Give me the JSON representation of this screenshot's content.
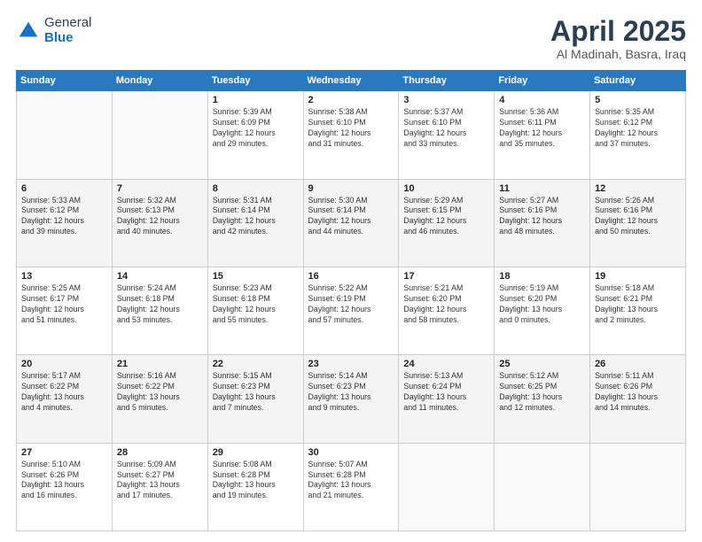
{
  "header": {
    "logo_general": "General",
    "logo_blue": "Blue",
    "title": "April 2025",
    "subtitle": "Al Madinah, Basra, Iraq"
  },
  "days_of_week": [
    "Sunday",
    "Monday",
    "Tuesday",
    "Wednesday",
    "Thursday",
    "Friday",
    "Saturday"
  ],
  "weeks": [
    [
      {
        "day": "",
        "detail": ""
      },
      {
        "day": "",
        "detail": ""
      },
      {
        "day": "1",
        "detail": "Sunrise: 5:39 AM\nSunset: 6:09 PM\nDaylight: 12 hours\nand 29 minutes."
      },
      {
        "day": "2",
        "detail": "Sunrise: 5:38 AM\nSunset: 6:10 PM\nDaylight: 12 hours\nand 31 minutes."
      },
      {
        "day": "3",
        "detail": "Sunrise: 5:37 AM\nSunset: 6:10 PM\nDaylight: 12 hours\nand 33 minutes."
      },
      {
        "day": "4",
        "detail": "Sunrise: 5:36 AM\nSunset: 6:11 PM\nDaylight: 12 hours\nand 35 minutes."
      },
      {
        "day": "5",
        "detail": "Sunrise: 5:35 AM\nSunset: 6:12 PM\nDaylight: 12 hours\nand 37 minutes."
      }
    ],
    [
      {
        "day": "6",
        "detail": "Sunrise: 5:33 AM\nSunset: 6:12 PM\nDaylight: 12 hours\nand 39 minutes."
      },
      {
        "day": "7",
        "detail": "Sunrise: 5:32 AM\nSunset: 6:13 PM\nDaylight: 12 hours\nand 40 minutes."
      },
      {
        "day": "8",
        "detail": "Sunrise: 5:31 AM\nSunset: 6:14 PM\nDaylight: 12 hours\nand 42 minutes."
      },
      {
        "day": "9",
        "detail": "Sunrise: 5:30 AM\nSunset: 6:14 PM\nDaylight: 12 hours\nand 44 minutes."
      },
      {
        "day": "10",
        "detail": "Sunrise: 5:29 AM\nSunset: 6:15 PM\nDaylight: 12 hours\nand 46 minutes."
      },
      {
        "day": "11",
        "detail": "Sunrise: 5:27 AM\nSunset: 6:16 PM\nDaylight: 12 hours\nand 48 minutes."
      },
      {
        "day": "12",
        "detail": "Sunrise: 5:26 AM\nSunset: 6:16 PM\nDaylight: 12 hours\nand 50 minutes."
      }
    ],
    [
      {
        "day": "13",
        "detail": "Sunrise: 5:25 AM\nSunset: 6:17 PM\nDaylight: 12 hours\nand 51 minutes."
      },
      {
        "day": "14",
        "detail": "Sunrise: 5:24 AM\nSunset: 6:18 PM\nDaylight: 12 hours\nand 53 minutes."
      },
      {
        "day": "15",
        "detail": "Sunrise: 5:23 AM\nSunset: 6:18 PM\nDaylight: 12 hours\nand 55 minutes."
      },
      {
        "day": "16",
        "detail": "Sunrise: 5:22 AM\nSunset: 6:19 PM\nDaylight: 12 hours\nand 57 minutes."
      },
      {
        "day": "17",
        "detail": "Sunrise: 5:21 AM\nSunset: 6:20 PM\nDaylight: 12 hours\nand 58 minutes."
      },
      {
        "day": "18",
        "detail": "Sunrise: 5:19 AM\nSunset: 6:20 PM\nDaylight: 13 hours\nand 0 minutes."
      },
      {
        "day": "19",
        "detail": "Sunrise: 5:18 AM\nSunset: 6:21 PM\nDaylight: 13 hours\nand 2 minutes."
      }
    ],
    [
      {
        "day": "20",
        "detail": "Sunrise: 5:17 AM\nSunset: 6:22 PM\nDaylight: 13 hours\nand 4 minutes."
      },
      {
        "day": "21",
        "detail": "Sunrise: 5:16 AM\nSunset: 6:22 PM\nDaylight: 13 hours\nand 5 minutes."
      },
      {
        "day": "22",
        "detail": "Sunrise: 5:15 AM\nSunset: 6:23 PM\nDaylight: 13 hours\nand 7 minutes."
      },
      {
        "day": "23",
        "detail": "Sunrise: 5:14 AM\nSunset: 6:23 PM\nDaylight: 13 hours\nand 9 minutes."
      },
      {
        "day": "24",
        "detail": "Sunrise: 5:13 AM\nSunset: 6:24 PM\nDaylight: 13 hours\nand 11 minutes."
      },
      {
        "day": "25",
        "detail": "Sunrise: 5:12 AM\nSunset: 6:25 PM\nDaylight: 13 hours\nand 12 minutes."
      },
      {
        "day": "26",
        "detail": "Sunrise: 5:11 AM\nSunset: 6:26 PM\nDaylight: 13 hours\nand 14 minutes."
      }
    ],
    [
      {
        "day": "27",
        "detail": "Sunrise: 5:10 AM\nSunset: 6:26 PM\nDaylight: 13 hours\nand 16 minutes."
      },
      {
        "day": "28",
        "detail": "Sunrise: 5:09 AM\nSunset: 6:27 PM\nDaylight: 13 hours\nand 17 minutes."
      },
      {
        "day": "29",
        "detail": "Sunrise: 5:08 AM\nSunset: 6:28 PM\nDaylight: 13 hours\nand 19 minutes."
      },
      {
        "day": "30",
        "detail": "Sunrise: 5:07 AM\nSunset: 6:28 PM\nDaylight: 13 hours\nand 21 minutes."
      },
      {
        "day": "",
        "detail": ""
      },
      {
        "day": "",
        "detail": ""
      },
      {
        "day": "",
        "detail": ""
      }
    ]
  ]
}
